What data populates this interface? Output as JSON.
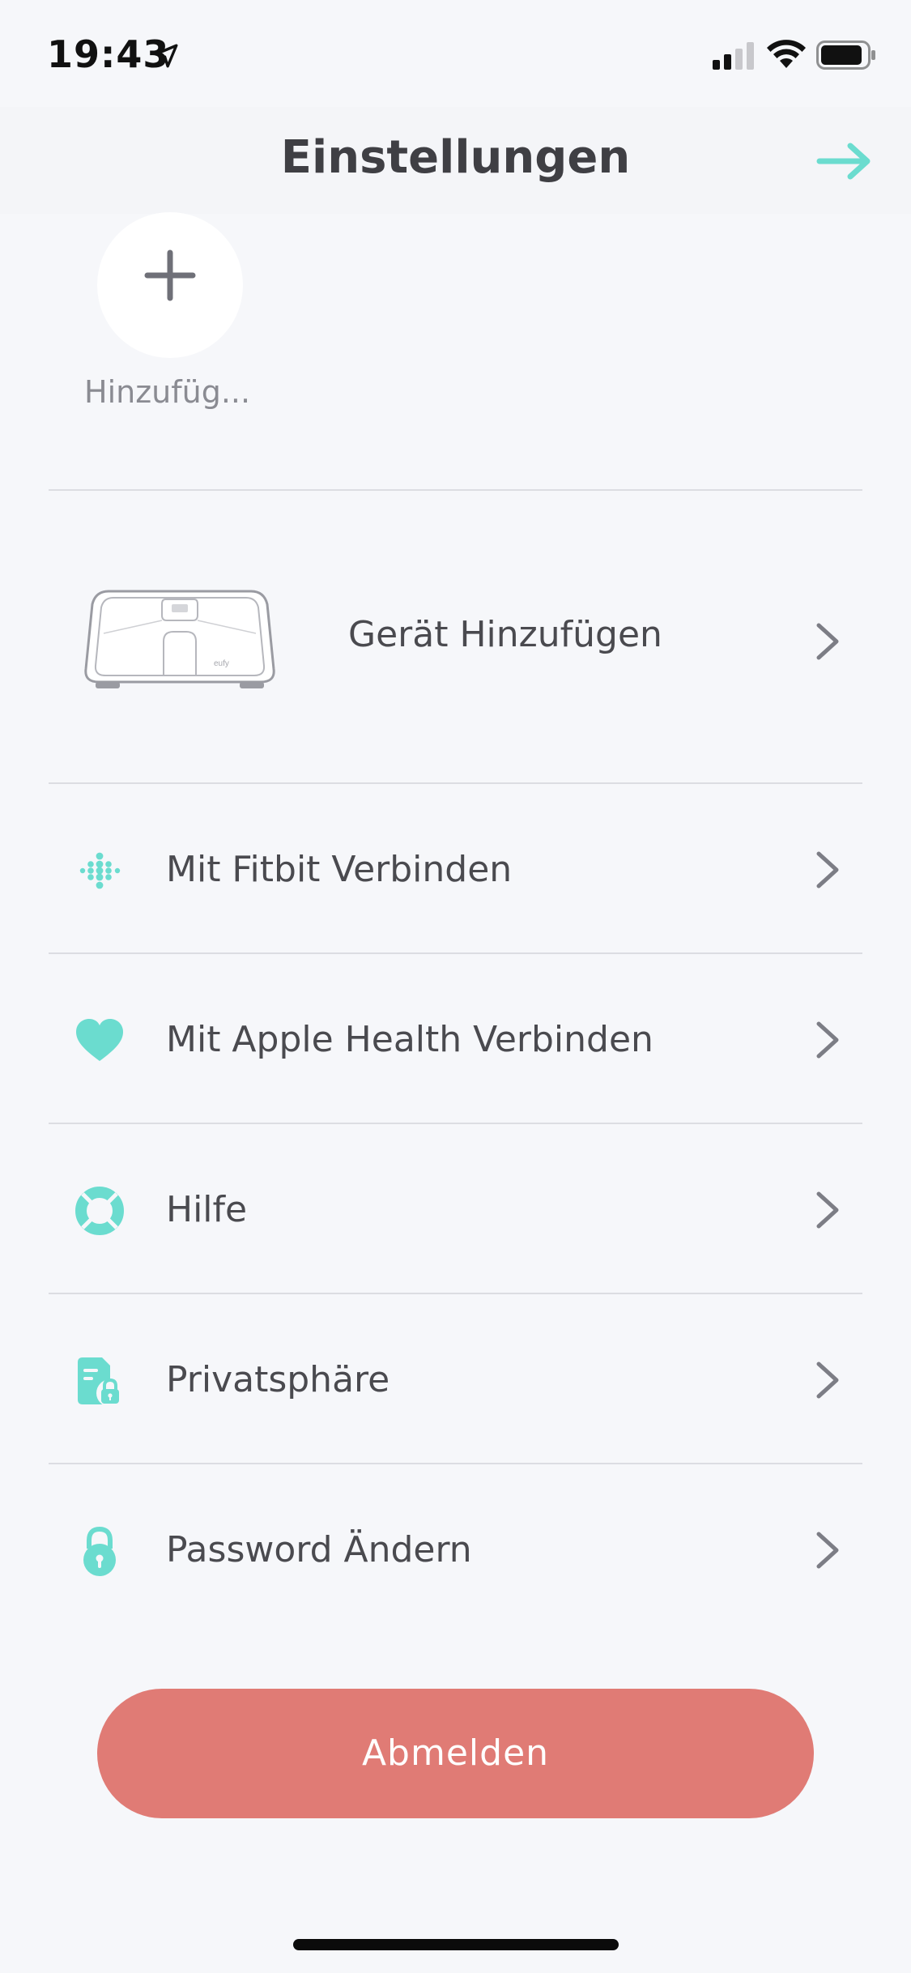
{
  "status_bar": {
    "time": "19:43",
    "icons": [
      "location-arrow-icon",
      "cellular-signal-icon",
      "wifi-icon",
      "battery-icon"
    ]
  },
  "header": {
    "title": "Einstellungen",
    "forward_icon": "arrow-right-icon"
  },
  "profile": {
    "add_label": "Hinzufüg...",
    "add_icon": "plus-icon"
  },
  "device": {
    "label": "Gerät Hinzufügen",
    "image": "smart-scale-illustration",
    "brand_mark": "eufy"
  },
  "menu": [
    {
      "label": "Mit Fitbit Verbinden",
      "icon": "fitbit-icon"
    },
    {
      "label": "Mit Apple Health Verbinden",
      "icon": "heart-icon"
    },
    {
      "label": "Hilfe",
      "icon": "lifebuoy-icon"
    },
    {
      "label": "Privatsphäre",
      "icon": "privacy-document-lock-icon"
    },
    {
      "label": "Password Ändern",
      "icon": "padlock-icon"
    }
  ],
  "logout": {
    "label": "Abmelden"
  },
  "colors": {
    "accent": "#6bdccf",
    "logout": "#e07b75",
    "background": "#f6f7fa",
    "text": "#4a4a4f",
    "chevron": "#7c7d85"
  }
}
